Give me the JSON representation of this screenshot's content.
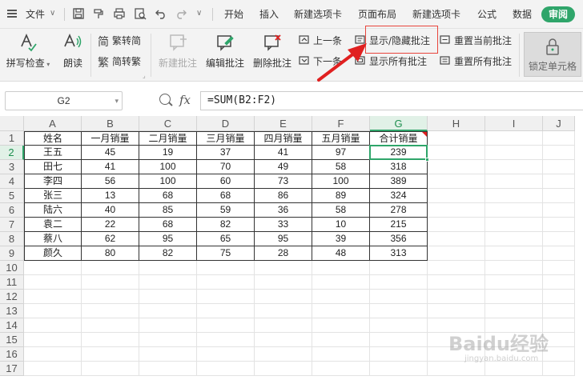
{
  "menu": {
    "file_label": "文件",
    "tabs": [
      "开始",
      "插入",
      "新建选项卡",
      "页面布局",
      "新建选项卡",
      "公式",
      "数据"
    ],
    "active_tab": "审阅"
  },
  "ribbon": {
    "spellcheck": "拼写检查",
    "read_aloud": "朗读",
    "trad_to_simp": "繁转简",
    "simp_to_trad": "简转繁",
    "new_comment": "新建批注",
    "edit_comment": "编辑批注",
    "delete_comment": "删除批注",
    "prev_comment": "上一条",
    "next_comment": "下一条",
    "show_hide_comment": "显示/隐藏批注",
    "show_all_comments": "显示所有批注",
    "reset_current_comment": "重置当前批注",
    "reset_all_comments": "重置所有批注",
    "lock_cell": "锁定单元格"
  },
  "formula_bar": {
    "name_box": "G2",
    "fx": "fx",
    "formula": "=SUM(B2:F2)"
  },
  "grid": {
    "columns": [
      "A",
      "B",
      "C",
      "D",
      "E",
      "F",
      "G",
      "H",
      "I",
      "J"
    ],
    "rows": [
      "1",
      "2",
      "3",
      "4",
      "5",
      "6",
      "7",
      "8",
      "9",
      "10",
      "11",
      "12",
      "13",
      "14",
      "15",
      "16",
      "17"
    ],
    "active_cell": "G2",
    "header_row": [
      "姓名",
      "一月销量",
      "二月销量",
      "三月销量",
      "四月销量",
      "五月销量",
      "合计销量"
    ],
    "data_rows": [
      [
        "王五",
        "45",
        "19",
        "37",
        "41",
        "97",
        "239"
      ],
      [
        "田七",
        "41",
        "100",
        "70",
        "49",
        "58",
        "318"
      ],
      [
        "李四",
        "56",
        "100",
        "60",
        "73",
        "100",
        "389"
      ],
      [
        "张三",
        "13",
        "68",
        "68",
        "86",
        "89",
        "324"
      ],
      [
        "陆六",
        "40",
        "85",
        "59",
        "36",
        "58",
        "278"
      ],
      [
        "袁二",
        "22",
        "68",
        "82",
        "33",
        "10",
        "215"
      ],
      [
        "蔡八",
        "62",
        "95",
        "65",
        "95",
        "39",
        "356"
      ],
      [
        "颜久",
        "80",
        "82",
        "75",
        "28",
        "48",
        "313"
      ]
    ]
  },
  "watermark": {
    "text": "Baidu经验",
    "sub": "jingyan.baidu.com"
  },
  "colors": {
    "accent_green": "#2fa56a",
    "highlight_red": "#e8453c",
    "arrow_red": "#e02020"
  }
}
